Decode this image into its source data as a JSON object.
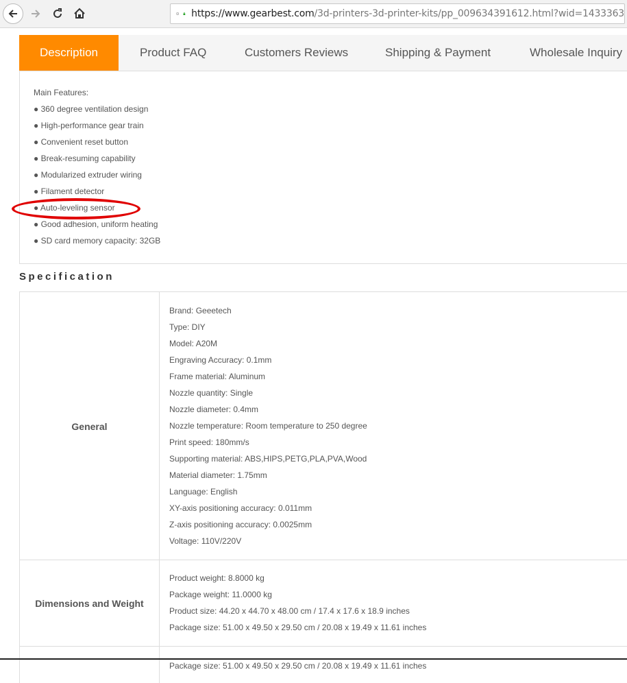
{
  "browser": {
    "url_host": "https://www.gearbest.com",
    "url_path": "/3d-printers-3d-printer-kits/pp_009634391612.html?wid=1433363"
  },
  "tabs": [
    {
      "label": "Description",
      "active": true
    },
    {
      "label": "Product FAQ",
      "active": false
    },
    {
      "label": "Customers Reviews",
      "active": false
    },
    {
      "label": "Shipping & Payment",
      "active": false
    },
    {
      "label": "Wholesale Inquiry",
      "active": false
    }
  ],
  "features": {
    "title": "Main Features:",
    "items": [
      "● 360 degree ventilation design",
      "● High-performance gear train",
      "● Convenient reset button",
      "● Break-resuming capability",
      "● Modularized extruder wiring",
      "● Filament detector",
      "● Auto-leveling sensor",
      "● Good adhesion, uniform heating",
      "● SD card memory capacity: 32GB"
    ]
  },
  "specification": {
    "title": "Specification",
    "general": {
      "label": "General",
      "lines": [
        "Brand: Geeetech",
        "Type: DIY",
        "Model: A20M",
        "Engraving Accuracy: 0.1mm",
        "Frame material: Aluminum",
        "Nozzle quantity: Single",
        "Nozzle diameter: 0.4mm",
        "Nozzle temperature: Room temperature to 250 degree",
        "Print speed: 180mm/s",
        "Supporting material: ABS,HIPS,PETG,PLA,PVA,Wood",
        "Material diameter: 1.75mm",
        "Language: English",
        "XY-axis positioning accuracy: 0.011mm",
        "Z-axis positioning accuracy: 0.0025mm",
        "Voltage: 110V/220V"
      ]
    },
    "dimensions": {
      "label": "Dimensions and Weight",
      "lines": [
        "Product weight: 8.8000 kg",
        "Package weight: 11.0000 kg",
        "Product size: 44.20 x 44.70 x 48.00 cm / 17.4 x 17.6 x 18.9 inches",
        "Package size: 51.00 x 49.50 x 29.50 cm / 20.08 x 19.49 x 11.61 inches"
      ]
    },
    "overflow_line": "Package size: 51.00 x 49.50 x 29.50 cm / 20.08 x 19.49 x 11.61 inches"
  },
  "colors": {
    "accent": "#ff8a00",
    "annotation": "#e00000"
  }
}
